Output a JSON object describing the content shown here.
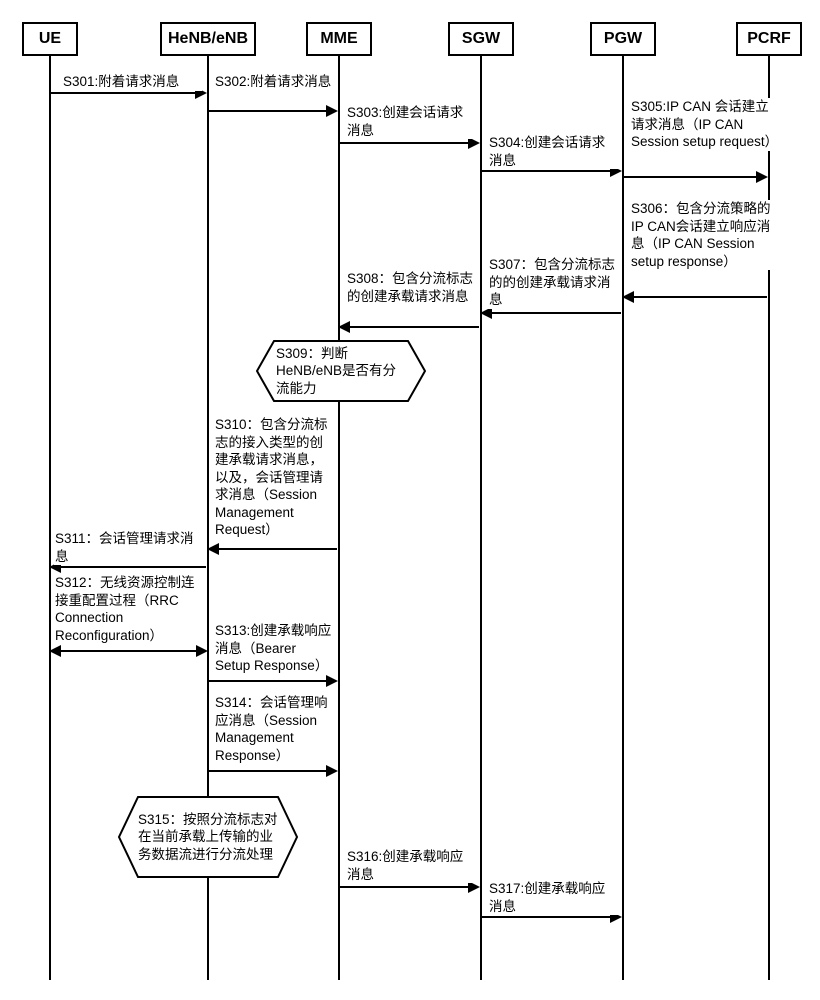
{
  "participants": {
    "ue": "UE",
    "henb": "HeNB/eNB",
    "mme": "MME",
    "sgw": "SGW",
    "pgw": "PGW",
    "pcrf": "PCRF"
  },
  "messages": {
    "s301": "S301:附着请求消息",
    "s302": "S302:附着请求消息",
    "s303": "S303:创建会话请求消息",
    "s304": "S304:创建会话请求消息",
    "s305": "S305:IP CAN 会话建立请求消息（IP CAN Session setup request）",
    "s306": "S306：包含分流策略的IP CAN会话建立响应消息（IP CAN Session setup response）",
    "s307": "S307：包含分流标志的的创建承载请求消息",
    "s308": "S308：包含分流标志的创建承载请求消息",
    "s309": "S309：判断HeNB/eNB是否有分流能力",
    "s310": "S310：包含分流标志的接入类型的创建承载请求消息，以及，会话管理请求消息（Session Management Request）",
    "s311": "S311：会话管理请求消息",
    "s312": "S312：无线资源控制连接重配置过程（RRC Connection Reconfiguration）",
    "s313": "S313:创建承载响应消息（Bearer Setup Response）",
    "s314": "S314：会话管理响应消息（Session Management Response）",
    "s315": "S315：按照分流标志对在当前承载上传输的业务数据流进行分流处理",
    "s316": "S316:创建承载响应消息",
    "s317": "S317:创建承载响应消息"
  },
  "flows": [
    {
      "id": "s301",
      "from": "ue",
      "to": "henb",
      "dir": "right"
    },
    {
      "id": "s302",
      "from": "henb",
      "to": "mme",
      "dir": "right"
    },
    {
      "id": "s303",
      "from": "mme",
      "to": "sgw",
      "dir": "right"
    },
    {
      "id": "s304",
      "from": "sgw",
      "to": "pgw",
      "dir": "right"
    },
    {
      "id": "s305",
      "from": "pgw",
      "to": "pcrf",
      "dir": "right"
    },
    {
      "id": "s306",
      "from": "pcrf",
      "to": "pgw",
      "dir": "left"
    },
    {
      "id": "s307",
      "from": "pgw",
      "to": "sgw",
      "dir": "left"
    },
    {
      "id": "s308",
      "from": "sgw",
      "to": "mme",
      "dir": "left"
    },
    {
      "id": "s309",
      "at": "mme",
      "type": "decision"
    },
    {
      "id": "s310",
      "from": "mme",
      "to": "henb",
      "dir": "left"
    },
    {
      "id": "s311",
      "from": "henb",
      "to": "ue",
      "dir": "left"
    },
    {
      "id": "s312",
      "between": [
        "ue",
        "henb"
      ],
      "dir": "both"
    },
    {
      "id": "s313",
      "from": "henb",
      "to": "mme",
      "dir": "right"
    },
    {
      "id": "s314",
      "from": "henb",
      "to": "mme",
      "dir": "right"
    },
    {
      "id": "s315",
      "at": "henb",
      "type": "process"
    },
    {
      "id": "s316",
      "from": "mme",
      "to": "sgw",
      "dir": "right"
    },
    {
      "id": "s317",
      "from": "sgw",
      "to": "pgw",
      "dir": "right"
    }
  ]
}
